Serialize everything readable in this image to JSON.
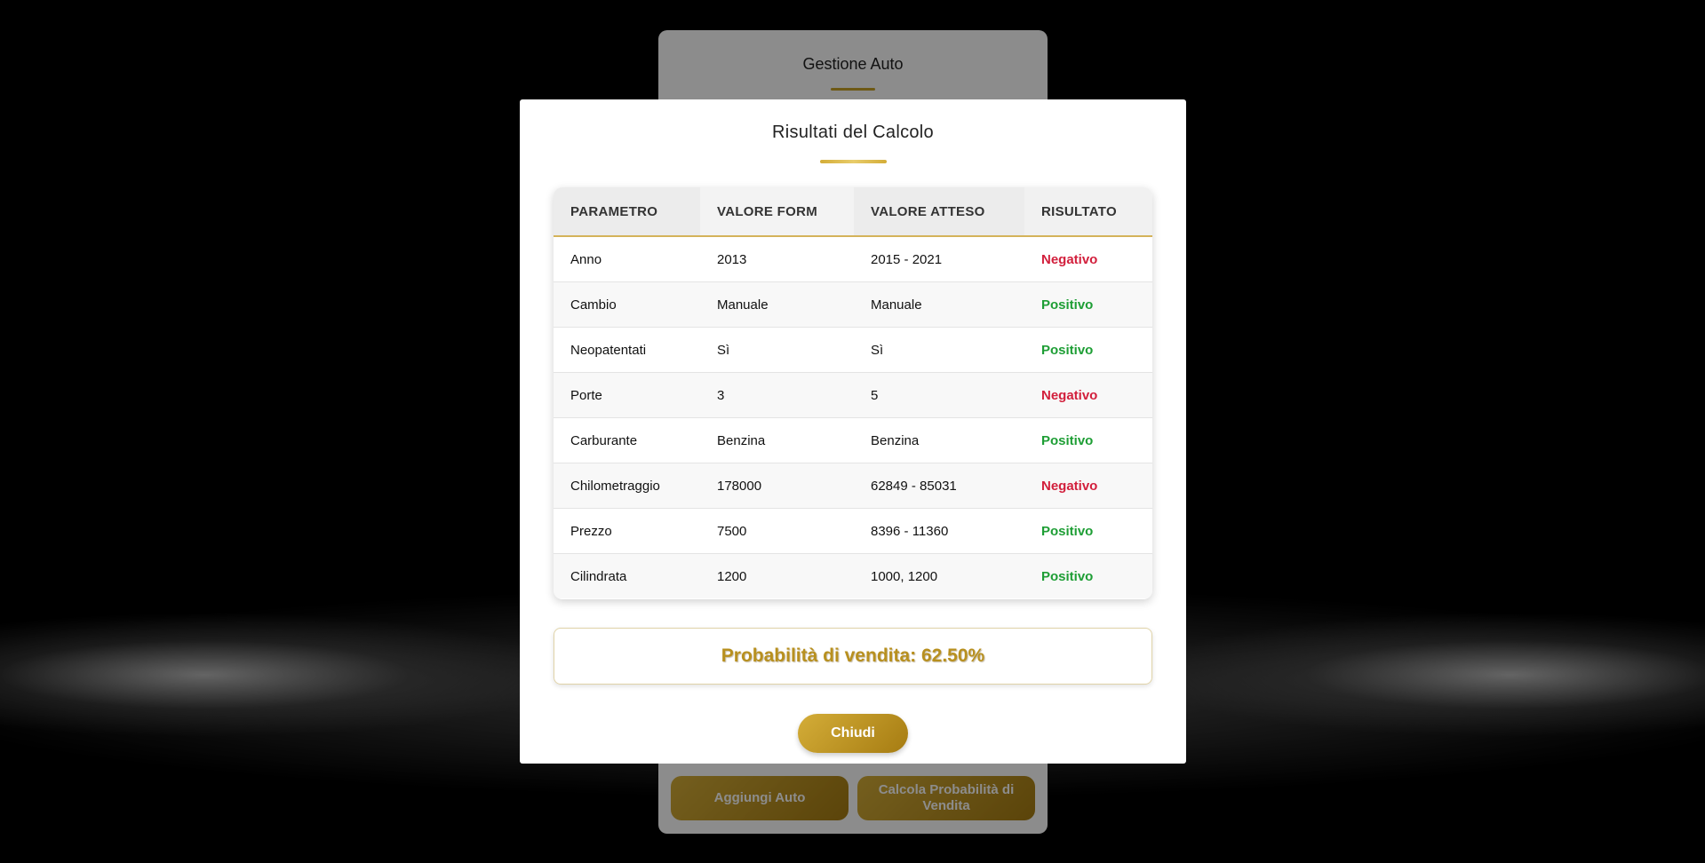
{
  "background": {
    "card_title": "Gestione Auto",
    "buttons": {
      "add_car": "Aggiungi Auto",
      "calc_prob": "Calcola Probabilità di Vendita"
    }
  },
  "modal": {
    "title": "Risultati del Calcolo",
    "table": {
      "headers": [
        "PARAMETRO",
        "VALORE FORM",
        "VALORE ATTESO",
        "RISULTATO"
      ],
      "rows": [
        {
          "param": "Anno",
          "form": "2013",
          "expected": "2015 - 2021",
          "result": "Negativo"
        },
        {
          "param": "Cambio",
          "form": "Manuale",
          "expected": "Manuale",
          "result": "Positivo"
        },
        {
          "param": "Neopatentati",
          "form": "Sì",
          "expected": "Sì",
          "result": "Positivo"
        },
        {
          "param": "Porte",
          "form": "3",
          "expected": "5",
          "result": "Negativo"
        },
        {
          "param": "Carburante",
          "form": "Benzina",
          "expected": "Benzina",
          "result": "Positivo"
        },
        {
          "param": "Chilometraggio",
          "form": "178000",
          "expected": "62849 - 85031",
          "result": "Negativo"
        },
        {
          "param": "Prezzo",
          "form": "7500",
          "expected": "8396 - 11360",
          "result": "Positivo"
        },
        {
          "param": "Cilindrata",
          "form": "1200",
          "expected": "1000, 1200",
          "result": "Positivo"
        }
      ]
    },
    "probability_text": "Probabilità di vendita: 62.50%",
    "close_label": "Chiudi"
  },
  "colors": {
    "accent_gold": "#c9a227",
    "negative": "#d21f3c",
    "positive": "#1e9e35"
  }
}
